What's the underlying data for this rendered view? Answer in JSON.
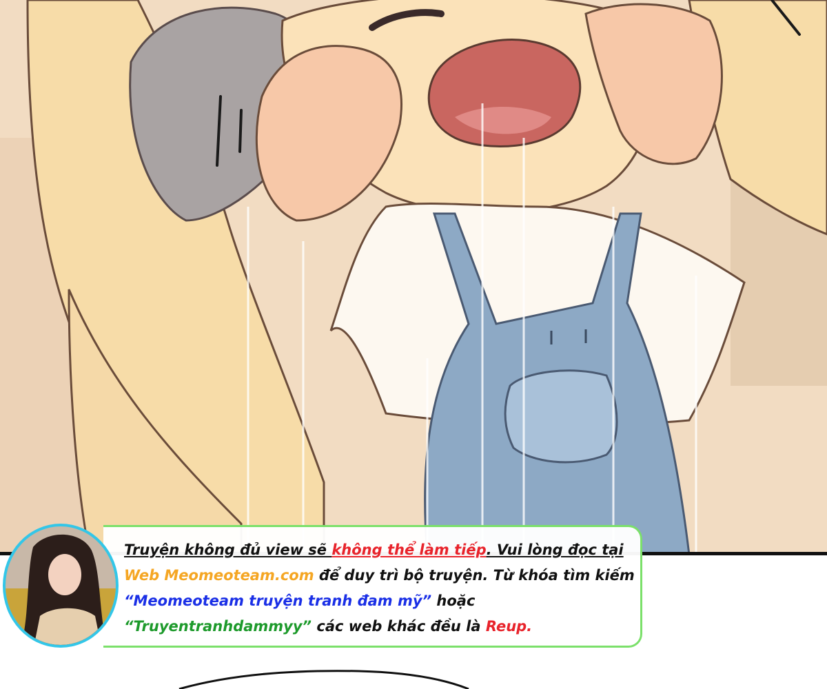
{
  "notice": {
    "line1": {
      "part1": "Truyện không đủ view sẽ ",
      "part2": "không thể làm tiếp",
      "part3": ". Vui lòng đọc tại"
    },
    "line2": {
      "part1": "Web Meomeoteam.com",
      "part2": " để duy trì bộ truyện. Từ khóa tìm kiếm"
    },
    "line3": {
      "part1": "“Meomeoteam truyện tranh đam mỹ”",
      "part2": " hoặc"
    },
    "line4": {
      "part1": "“Truyentranhdammyy”",
      "part2": " các web khác đều là ",
      "part3": "Reup."
    }
  },
  "colors": {
    "warning": "#e8232b",
    "site": "#f5a623",
    "keyword1": "#1a2fe6",
    "keyword2": "#1d9a2b",
    "frame_border": "#7be06a",
    "avatar_ring": "#33c6e8"
  }
}
